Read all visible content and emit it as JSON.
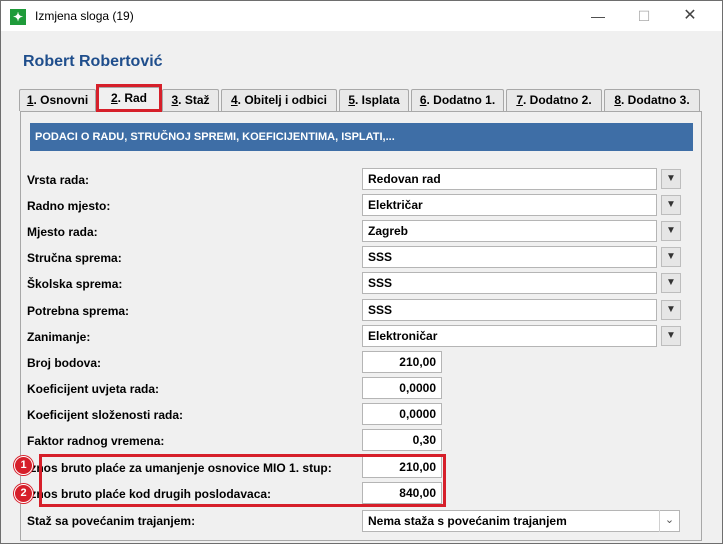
{
  "window": {
    "title": "Izmjena sloga (19)",
    "controls": {
      "minimize": "—",
      "maximize": "☐",
      "close": "✕"
    }
  },
  "person_name": "Robert Robertović",
  "tabs": [
    {
      "num": "1",
      "label": ". Osnovni"
    },
    {
      "num": "2",
      "label": ". Rad"
    },
    {
      "num": "3",
      "label": ". Staž"
    },
    {
      "num": "4",
      "label": ". Obitelj i odbici"
    },
    {
      "num": "5",
      "label": ". Isplata"
    },
    {
      "num": "6",
      "label": ". Dodatno 1."
    },
    {
      "num": "7",
      "label": ". Dodatno 2."
    },
    {
      "num": "8",
      "label": ". Dodatno 3."
    }
  ],
  "active_tab": "2. Rad",
  "section_header": "PODACI O RADU, STRUČNOJ SPREMI, KOEFICIJENTIMA, ISPLATI,...",
  "fields": [
    {
      "label": "Vrsta rada:",
      "value": "Redovan rad"
    },
    {
      "label": "Radno mjesto:",
      "value": "Električar"
    },
    {
      "label": "Mjesto rada:",
      "value": "Zagreb"
    },
    {
      "label": "Stručna sprema:",
      "value": "SSS"
    },
    {
      "label": "Školska sprema:",
      "value": "SSS"
    },
    {
      "label": "Potrebna sprema:",
      "value": "SSS"
    },
    {
      "label": "Zanimanje:",
      "value": "Elektroničar"
    },
    {
      "label": "Broj bodova:",
      "value": "210,00"
    },
    {
      "label": "Koeficijent uvjeta rada:",
      "value": "0,0000"
    },
    {
      "label": "Koeficijent složenosti rada:",
      "value": "0,0000"
    },
    {
      "label": "Faktor radnog vremena:",
      "value": "0,30"
    },
    {
      "label": "Iznos bruto plaće za umanjenje osnovice MIO 1. stup:",
      "value": "210,00"
    },
    {
      "label": "Iznos bruto plaće kod drugih poslodavaca:",
      "value": "840,00"
    },
    {
      "label": "Staž sa povećanim trajanjem:",
      "value": "Nema staža s povećanim trajanjem"
    }
  ],
  "markers": [
    "1",
    "2"
  ],
  "colors": {
    "accent": "#3e6ea6",
    "title_blue": "#1f4e8c",
    "highlight": "#d61f2a"
  },
  "icons": {
    "dropdown": "arrow-down-icon",
    "combo": "chevron-down-icon",
    "app": "app-logo-icon"
  }
}
